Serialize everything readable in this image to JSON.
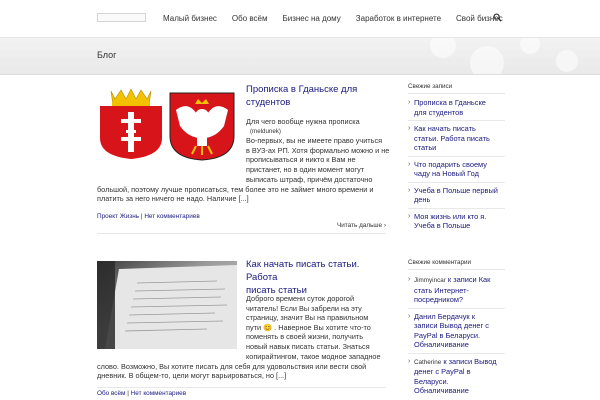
{
  "header": {
    "nav": [
      "Малый бизнес",
      "Обо всём",
      "Бизнес на дому",
      "Заработок в интернете",
      "Свой бизнес"
    ],
    "search_icon": "search-icon"
  },
  "page": {
    "title": "Блог"
  },
  "posts": [
    {
      "title_lines": [
        "Прописка в Гданьске для",
        "студентов"
      ],
      "text_lines_right": [
        "Для чего вообще нужна прописка",
        "(meldunek)",
        "Во-первых, вы не имеете право учиться",
        "в ВУЗ-ах РП. Хотя формально можно и не",
        "прописываться и никто к Вам не",
        "пристанет, но в один момент могут"
      ],
      "text_lines_full": [
        "выписать штраф, причём достаточно",
        "большой, поэтому лучше прописаться, тем более это не займет много времени и",
        "платить за него ничего не надо. Наличие [...]"
      ],
      "category": "Проект Жизнь",
      "comments": "Нет комментариев",
      "read_more": "Читать дальше ›",
      "image": "gdansk-and-poland-coat-of-arms"
    },
    {
      "title_lines": [
        "Как начать писать статьи. Работа",
        "писать статьи"
      ],
      "text_lines_right": [
        "Доброго времени суток дорогой",
        "читатель! Если Вы забрели на эту",
        "страницу, значит Вы на правильном",
        "пути 😊 . Наверное Вы хотите что-то",
        "поменять в своей жизни, получить",
        "новый навык писать статьи. Знаться"
      ],
      "text_lines_full": [
        "копирайтингом, такое модное западное",
        "слово. Возможно, Вы хотите писать для себя для удовольствия или вести свой",
        "дневник. В общем-то, цели могут варьироваться, но [...]"
      ],
      "category": "Обо всём",
      "comments": "Нет комментариев",
      "image": "laptop-screen-photo"
    }
  ],
  "sidebar": {
    "recent_heading": "Свежие записи",
    "recent": [
      [
        "Прописка в Гданьске",
        "для студентов"
      ],
      [
        "Как начать писать",
        "статьи. Работа писать",
        "статьи"
      ],
      [
        "Что подарить своему",
        "чаду на Новый Год"
      ],
      [
        "Учеба в Польше первый",
        "день"
      ],
      [
        "Моя жизнь или кто я.",
        "Учеба в Польше"
      ]
    ],
    "comments_heading": "Свежие комментарии",
    "comments": [
      {
        "author": "Jimmyincar",
        "lines": [
          "к записи Как",
          "стать Интернет-",
          "посредником?"
        ]
      },
      {
        "author": "Данил Бердачук",
        "lines": [
          "к",
          "записи Вывод денег с",
          "PayPal в Беларуси.",
          "Обналичивание"
        ]
      },
      {
        "author": "Catherine",
        "lines": [
          "к записи Вывод",
          "денег с PayPal в",
          "Беларуси.",
          "Обналичивание"
        ]
      }
    ]
  }
}
